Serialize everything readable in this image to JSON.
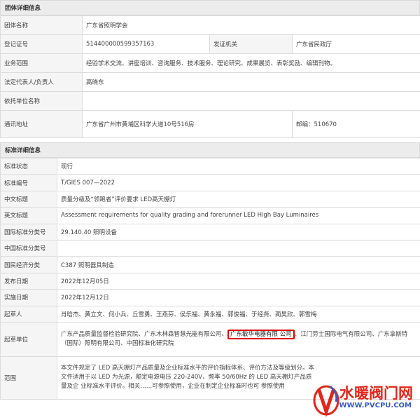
{
  "org": {
    "section_title": "团体详细信息",
    "rows": [
      {
        "label": "团体名称",
        "value": "广东省照明学会"
      },
      {
        "label": "登记证号",
        "value": "514400000599357163",
        "label2": "发证机关",
        "value2": "广东省民政厅"
      },
      {
        "label": "业务范围",
        "value": "经验学术交流、讲座培训、咨询服务、技术服务、理论研究、成果展览、表彰奖励、编辑刊物。"
      },
      {
        "label": "法定代表人/负责人",
        "value": "高晓东"
      },
      {
        "label": "依托单位名称",
        "value": ""
      },
      {
        "label": "通讯地址",
        "value": "广东省广州市黄埔区科学大道10号516房",
        "postcode": "邮编：510670"
      }
    ]
  },
  "standard": {
    "section_title": "标准详细信息",
    "rows": [
      {
        "label": "标准状态",
        "value": "现行"
      },
      {
        "label": "标准编号",
        "value": "T/GIES 007—2022"
      },
      {
        "label": "中文标题",
        "value": "质量分级及“领跑者”评价要求 LED高天棚灯"
      },
      {
        "label": "英文标题",
        "value": "Assessment requirements for quality grading and forerunner LED High Bay Luminaires"
      },
      {
        "label": "国际标准分类号",
        "value": "29.140.40 照明设备"
      },
      {
        "label": "中国标准分类号",
        "value": ""
      },
      {
        "label": "国民经济分类",
        "value": "C387 照明器具制造"
      },
      {
        "label": "发布日期",
        "value": "2022年12月05日"
      },
      {
        "label": "实施日期",
        "value": "2022年12月12日"
      },
      {
        "label": "起草人",
        "value": "肖晗杰、黄立文、何小兵、丘雪勇、王燕芬、侯乐福、黄永福、郭俊福、于经尧、蔺昊欣、郭雪梅"
      }
    ],
    "drafting_units": {
      "label": "起草单位",
      "before": "广东产品质量监督检验研究院、广东木林森智慧光能有限公司、",
      "highlighted": "广东敏华电器有限 公司",
      "after": "、江门劳士国际电气有限公司、广东拿斯特（国际）照明有限公司、中国标准化研究院"
    },
    "scope": {
      "label": "范围",
      "value": "本文件规定了 LED 高天棚灯产品质量及企业标准水平的评价指标体系、评价方法及等级划分。本文件适用于以 LED 为光源，额定电源电压 220-240V、频率 50/60Hz 的 LED 高天棚灯产品质量及企 业标准水平评价。相关……可参照使用，企业在制定企业标准时也可 参照使用"
    }
  },
  "watermark": {
    "text": "水暖阀门网",
    "url": "WWW.PVCPU.COM",
    "logo_color": "#e0251b"
  }
}
